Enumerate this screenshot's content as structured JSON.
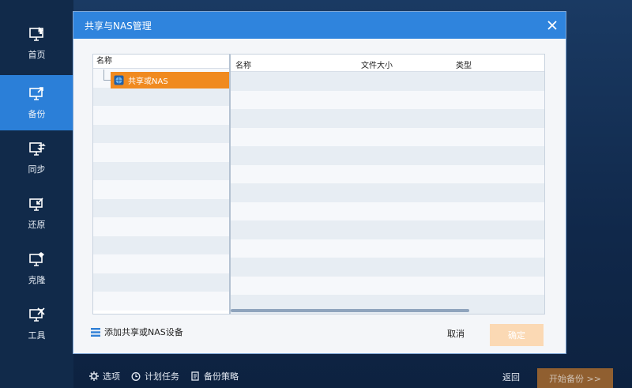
{
  "sidebar": {
    "items": [
      {
        "label": "首页",
        "icon": "home-monitor-icon"
      },
      {
        "label": "备份",
        "icon": "backup-icon",
        "active": true
      },
      {
        "label": "同步",
        "icon": "sync-icon"
      },
      {
        "label": "还原",
        "icon": "restore-icon"
      },
      {
        "label": "克隆",
        "icon": "clone-icon"
      },
      {
        "label": "工具",
        "icon": "tools-icon"
      }
    ]
  },
  "dialog": {
    "title": "共享与NAS管理",
    "tree": {
      "header": "名称",
      "node_label": "共享或NAS"
    },
    "list": {
      "columns": [
        "名称",
        "文件大小",
        "类型"
      ]
    },
    "add_button": "添加共享或NAS设备",
    "cancel_label": "取消",
    "ok_label": "确定"
  },
  "bottom_bar": {
    "options": "选项",
    "schedule": "计划任务",
    "policy": "备份策略",
    "back": "返回",
    "start": "开始备份 >>"
  },
  "colors": {
    "accent": "#2f84dd",
    "selected": "#f08a1f",
    "ok_disabled": "#fbd9b4"
  }
}
